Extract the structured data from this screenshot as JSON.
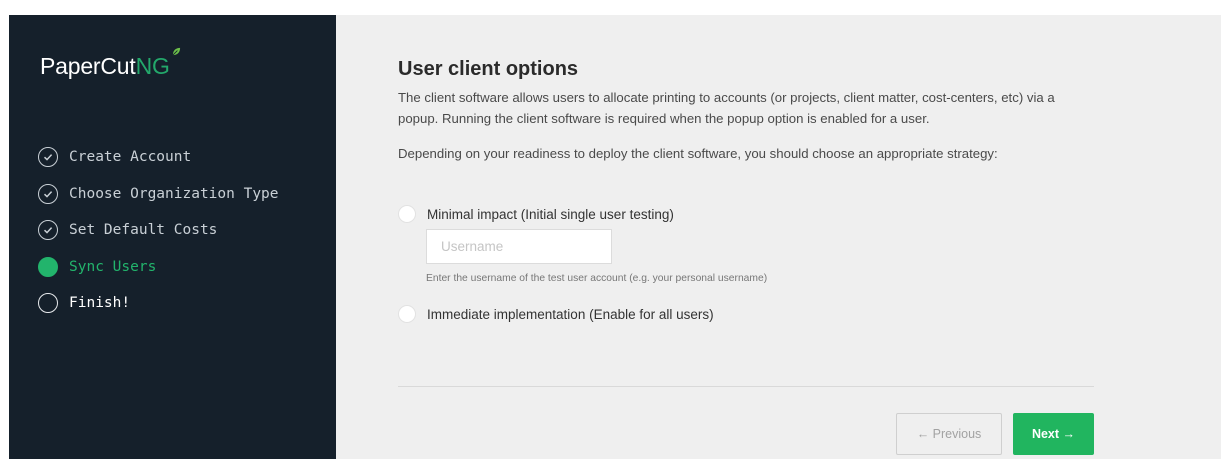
{
  "brand": {
    "name_part1": "PaperCut",
    "name_part2": "NG",
    "accent_color": "#22b46c",
    "leaf_icon": "leaf-icon"
  },
  "steps": [
    {
      "label": "Create Account",
      "state": "done",
      "icon": "check-circle-icon"
    },
    {
      "label": "Choose Organization Type",
      "state": "done",
      "icon": "check-circle-icon"
    },
    {
      "label": "Set Default Costs",
      "state": "done",
      "icon": "check-circle-icon"
    },
    {
      "label": "Sync Users",
      "state": "current",
      "icon": "filled-circle-icon"
    },
    {
      "label": "Finish!",
      "state": "upcoming",
      "icon": "empty-circle-icon"
    }
  ],
  "main": {
    "title": "User client options",
    "description": "The client software allows users to allocate printing to accounts (or projects, client matter, cost-centers, etc) via a popup. Running the client software is required when the popup option is enabled for a user.",
    "strategy_text": "Depending on your readiness to deploy the client software, you should choose an appropriate strategy:",
    "options": {
      "minimal": {
        "label": "Minimal impact (Initial single user testing)",
        "username_placeholder": "Username",
        "username_value": "",
        "hint": "Enter the username of the test user account (e.g. your personal username)"
      },
      "immediate": {
        "label": "Immediate implementation (Enable for all users)"
      }
    }
  },
  "footer": {
    "previous_label": "← Previous",
    "next_label": "Next →"
  }
}
